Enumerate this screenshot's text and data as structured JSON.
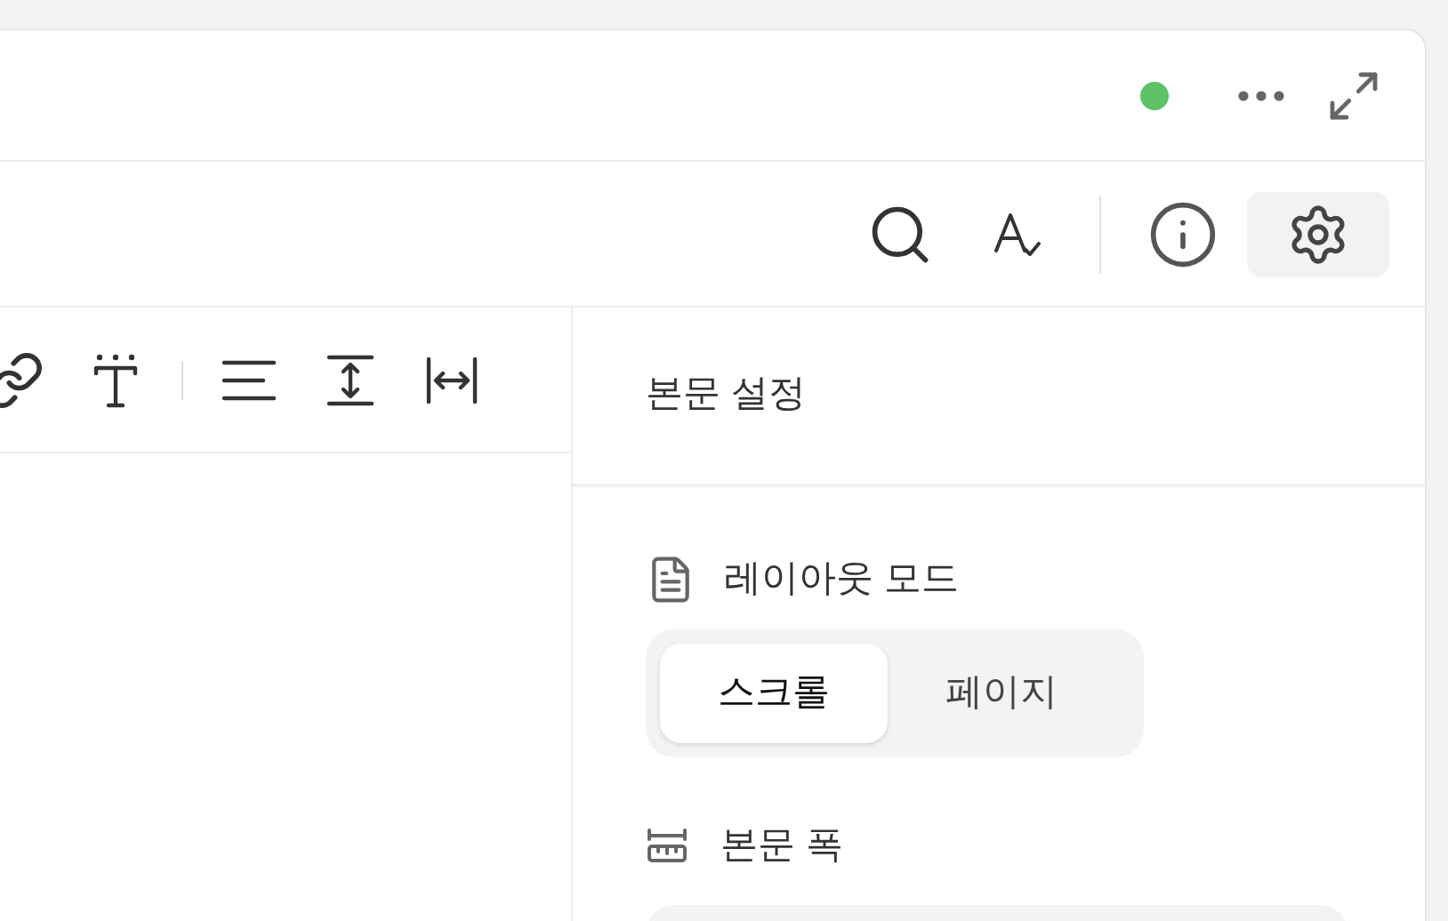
{
  "header": {
    "sync_connected": true
  },
  "top_toolbar": [
    {
      "kind": "search",
      "selected": false
    },
    {
      "kind": "spellcheck",
      "selected": false
    },
    {
      "kind": "divider"
    },
    {
      "kind": "info",
      "selected": false
    },
    {
      "kind": "settings",
      "selected": true
    }
  ],
  "format_toolbar": [
    {
      "kind": "link"
    },
    {
      "kind": "text-style"
    },
    {
      "kind": "divider"
    },
    {
      "kind": "align"
    },
    {
      "kind": "line-height"
    },
    {
      "kind": "letter-spacing"
    }
  ],
  "settings_panel": {
    "title": "본문 설정",
    "layout_mode": {
      "label": "레이아웃 모드",
      "options": [
        {
          "label": "스크롤",
          "selected": true
        },
        {
          "label": "페이지",
          "selected": false
        }
      ]
    },
    "body_width": {
      "label": "본문 폭"
    }
  }
}
